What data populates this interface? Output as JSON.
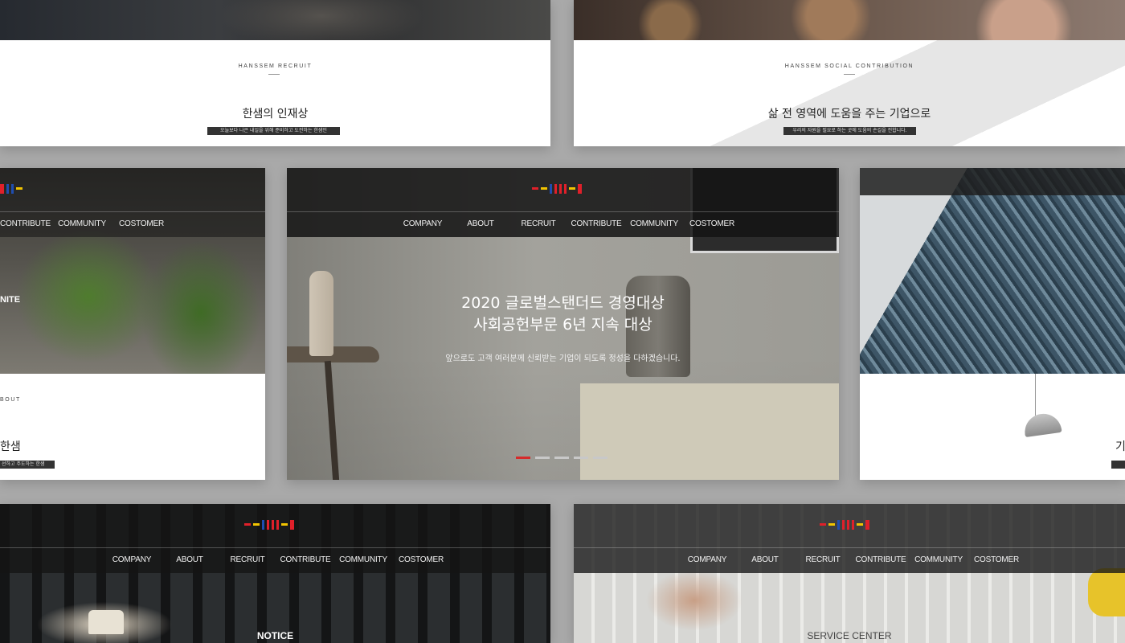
{
  "nav": {
    "items": [
      "COMPANY",
      "ABOUT",
      "RECRUIT",
      "CONTRIBUTE",
      "COMMUNITY",
      "COSTOMER"
    ]
  },
  "recruit_card": {
    "eyebrow": "HANSSEM RECRUIT",
    "title": "한샘의 인재상",
    "subtitle": "오늘보다 나은 내일을 위해 준비하고 도전하는 한샘인"
  },
  "social_card": {
    "eyebrow": "HANSSEM SOCIAL CONTRIBUTION",
    "title": "삶 전 영역에 도움을 주는 기업으로",
    "subtitle": "우리의 자원을 필요로 하는 곳에 도움의 손길을 전합니다."
  },
  "about_card": {
    "hero_fragment": "NITE",
    "eyebrow": "BOUT",
    "title": "한샘",
    "subtitle": "선하고 주도하는 한샘"
  },
  "center_card": {
    "hero_line1": "2020 글로벌스탠더드 경영대상",
    "hero_line2": "사회공헌부문 6년 지속 대상",
    "hero_sub": "앞으로도 고객 여러분께 신뢰받는 기업이 되도록 정성을 다하겠습니다.",
    "slides": [
      true,
      false,
      false,
      false,
      false
    ]
  },
  "right_card": {
    "title_fragment": "기"
  },
  "notice_card": {
    "label": "NOTICE"
  },
  "service_card": {
    "label": "SERVICE CENTER"
  },
  "colors": {
    "logo_red": "#e0202a",
    "logo_yellow": "#f2c400",
    "logo_blue": "#1f4db0",
    "active_dot": "#d62b2b"
  }
}
